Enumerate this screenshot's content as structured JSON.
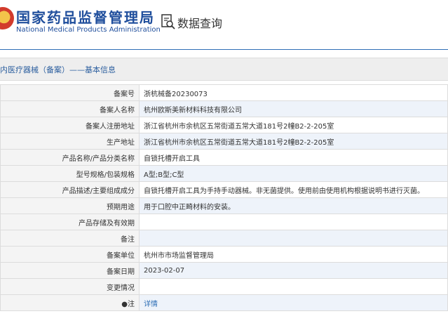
{
  "header": {
    "logo_cn": "国家药品监督管理局",
    "logo_en": "National Medical Products Administration",
    "query_title": "数据查询"
  },
  "section": {
    "title": "内医疗器械（备案）——基本信息"
  },
  "rows": [
    {
      "label": "备案号",
      "value": "浙杭械备20230073"
    },
    {
      "label": "备案人名称",
      "value": "杭州欧斯美新材料科技有限公司"
    },
    {
      "label": "备案人注册地址",
      "value": "浙江省杭州市余杭区五常街道五常大道181号2幢B2-2-205室"
    },
    {
      "label": "生产地址",
      "value": "浙江省杭州市余杭区五常街道五常大道181号2幢B2-2-205室"
    },
    {
      "label": "产品名称/产品分类名称",
      "value": "自锁托槽开启工具"
    },
    {
      "label": "型号规格/包装规格",
      "value": "A型;B型;C型"
    },
    {
      "label": "产品描述/主要组成成分",
      "value": "自锁托槽开启工具为手持手动器械。非无菌提供。使用前由使用机构根据说明书进行灭菌。"
    },
    {
      "label": "预期用途",
      "value": "用于口腔中正畸材料的安装。"
    },
    {
      "label": "产品存储及有效期",
      "value": ""
    },
    {
      "label": "备注",
      "value": ""
    },
    {
      "label": "备案单位",
      "value": "杭州市市场监督管理局"
    },
    {
      "label": "备案日期",
      "value": "2023-02-07"
    },
    {
      "label": "变更情况",
      "value": ""
    },
    {
      "label": "●注",
      "value": "详情",
      "link": true
    }
  ],
  "colors": {
    "brand_blue": "#1f4e9c",
    "link_blue": "#2f6fb6",
    "label_bg": "#f4f4f4",
    "stripe_bg": "#eef3fa"
  },
  "icons": {
    "logo": "emblem-icon",
    "query": "document-search-icon"
  }
}
